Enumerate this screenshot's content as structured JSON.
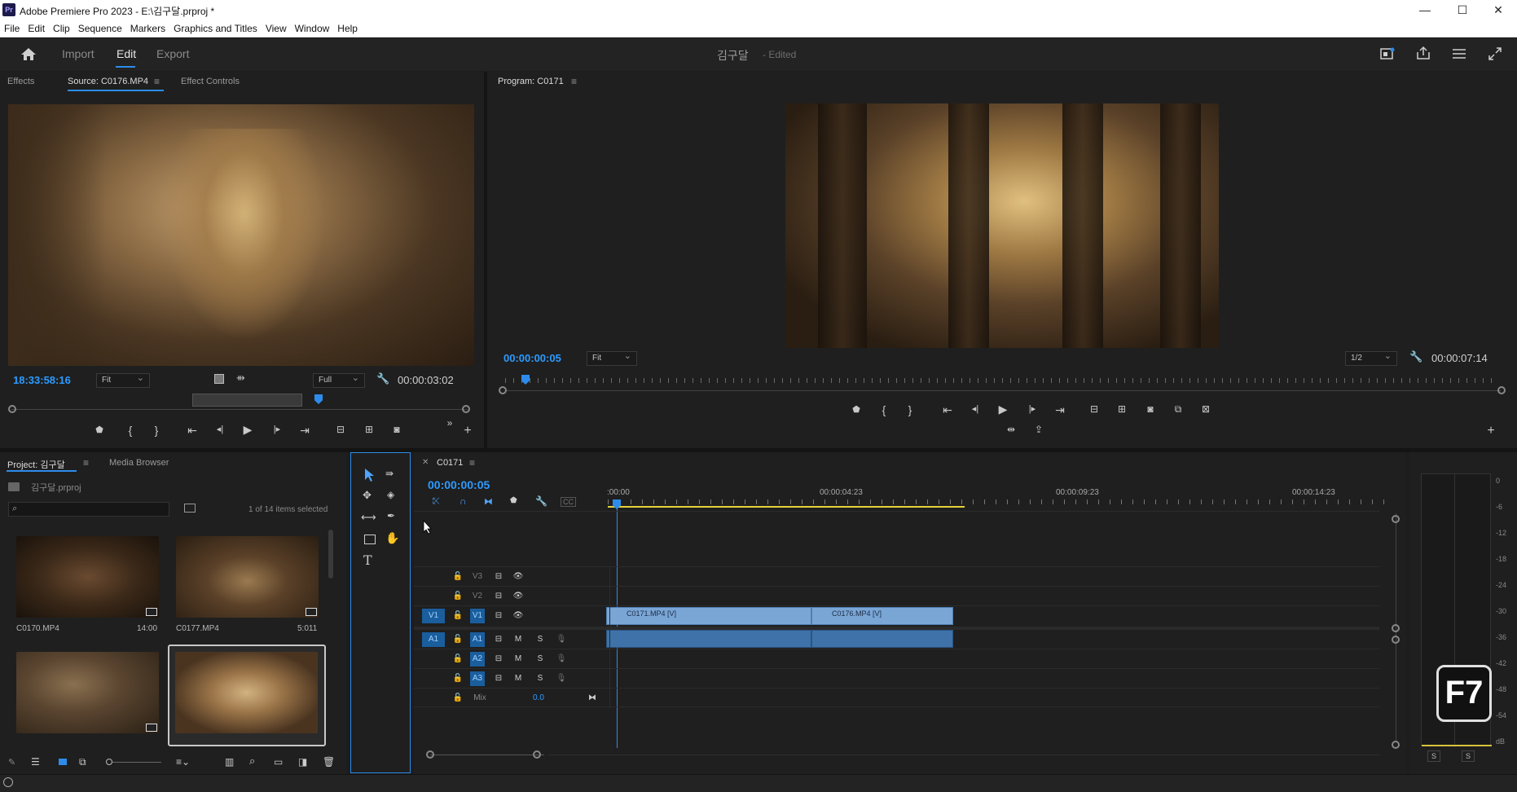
{
  "window": {
    "title": "Adobe Premiere Pro 2023 - E:\\김구달.prproj *",
    "app_badge": "Pr",
    "minimize": "—",
    "maximize": "☐",
    "close": "✕"
  },
  "menu": [
    "File",
    "Edit",
    "Clip",
    "Sequence",
    "Markers",
    "Graphics and Titles",
    "View",
    "Window",
    "Help"
  ],
  "header": {
    "tabs": [
      "Import",
      "Edit",
      "Export"
    ],
    "active_tab": "Edit",
    "project_name": "김구달",
    "project_status": "- Edited"
  },
  "source_panel": {
    "tabs": [
      "Effects",
      "Source: C0176.MP4",
      "Effect Controls"
    ],
    "active_tab": "Source: C0176.MP4",
    "timecode": "18:33:58:16",
    "fit": "Fit",
    "quality": "Full",
    "duration": "00:00:03:02"
  },
  "program_panel": {
    "title": "Program: C0171",
    "timecode": "00:00:00:05",
    "fit": "Fit",
    "resolution": "1/2",
    "duration": "00:00:07:14"
  },
  "project_panel": {
    "tabs": [
      "Project: 김구달",
      "Media Browser"
    ],
    "file": "김구달.prproj",
    "selection_status": "1 of 14 items selected",
    "items": [
      {
        "name": "C0170.MP4",
        "duration": "14:00"
      },
      {
        "name": "C0177.MP4",
        "duration": "5:011"
      },
      {
        "name": "",
        "duration": ""
      },
      {
        "name": "",
        "duration": ""
      }
    ]
  },
  "timeline": {
    "sequence": "C0171",
    "timecode": "00:00:00:05",
    "ruler": [
      ":00:00",
      "00:00:04:23",
      "00:00:09:23",
      "00:00:14:23"
    ],
    "tracks": [
      {
        "name": "V3",
        "type": "video"
      },
      {
        "name": "V2",
        "type": "video"
      },
      {
        "name": "V1",
        "type": "video",
        "source": "V1"
      },
      {
        "name": "A1",
        "type": "audio",
        "source": "A1"
      },
      {
        "name": "A2",
        "type": "audio"
      },
      {
        "name": "A3",
        "type": "audio"
      }
    ],
    "mix_label": "Mix",
    "mix_value": "0.0",
    "clips": [
      {
        "name": "C0171.MP4 [V]",
        "track": "V1"
      },
      {
        "name": "C0176.MP4 [V]",
        "track": "V1"
      }
    ],
    "m_label": "M",
    "s_label": "S"
  },
  "meter": {
    "scale": [
      "0",
      "-6",
      "-12",
      "-18",
      "-24",
      "-30",
      "-36",
      "-42",
      "-48",
      "-54",
      "dB"
    ],
    "solo_left": "S",
    "solo_right": "S"
  },
  "keycap": "F7"
}
